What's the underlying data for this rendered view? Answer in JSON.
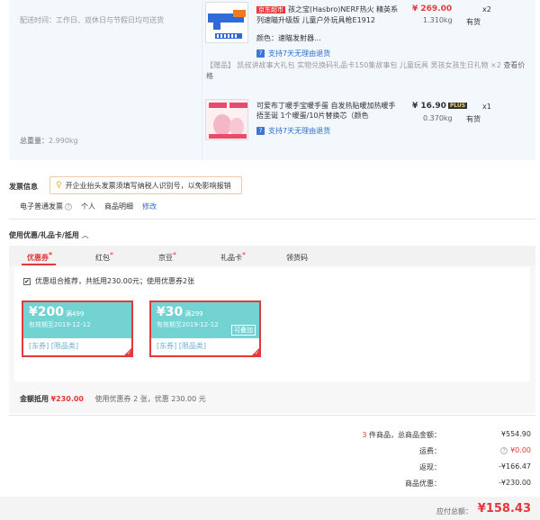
{
  "delivery": {
    "text": "配送时间：工作日、双休日与节假日均可送货"
  },
  "total_weight": {
    "label": "总重量：",
    "value": "2.990kg"
  },
  "products": [
    {
      "tag": "京东超市",
      "title": "孩之宝(Hasbro)NERF热火 精英系列速瞄升级版 儿童户外玩具枪E1912",
      "price": "¥ 269.00",
      "qty": "x2",
      "weight": "1.310kg",
      "stock": "有货",
      "color": "颜色：速瞄发射器...",
      "return": "支持7天无理由退货"
    },
    {
      "title": "可爱布丁暖手宝暖手蛋 自发热贴暖加热暖手捂圣诞 1个暖蛋/10片替换芯（颜色",
      "price": "¥ 16.90",
      "plus": "PLUS",
      "qty": "x1",
      "weight": "0.370kg",
      "stock": "有货",
      "return": "支持7天无理由退货"
    }
  ],
  "gift": {
    "label": "【赠品】",
    "text": "凯叔讲故事大礼包 实物兑换码礼品卡150集故事包 儿童玩具 男孩女孩生日礼物",
    "qty": "×2",
    "link": "查看价格"
  },
  "invoice": {
    "title": "发票信息",
    "tip": "开企业抬头发票须填写纳税人识别号，以免影响报销",
    "type": "电子普通发票",
    "person": "个人",
    "detail": "商品明细",
    "edit": "修改"
  },
  "coupons": {
    "title": "使用优惠/礼品卡/抵用",
    "arrow": "︿",
    "tabs": [
      {
        "label": "优惠券",
        "star": "*"
      },
      {
        "label": "红包",
        "star": "*"
      },
      {
        "label": "京豆",
        "star": "*"
      },
      {
        "label": "礼品卡",
        "star": "*"
      },
      {
        "label": "领货码",
        "star": ""
      }
    ],
    "combo_text": "优惠组合推荐，共抵用230.00元；使用优惠券2张",
    "combo_check": "✔",
    "items": [
      {
        "amount": "¥200",
        "cond": "满499",
        "expire": "有效期至2019-12-12",
        "tags": "[东券]  [限品类]",
        "stack": ""
      },
      {
        "amount": "¥30",
        "cond": "满299",
        "expire": "有效期至2019-12-12",
        "tags": "[东券]  [限品类]",
        "stack": "可叠加"
      }
    ],
    "deduct_label": "金额抵用",
    "deduct_value": "¥230.00",
    "deduct_note": "使用优惠券 2 张，优惠 230.00 元"
  },
  "summary": {
    "count_num": "3",
    "count_text": " 件商品，总商品金额：",
    "goods_total": "¥554.90",
    "shipping_label": "运费：",
    "shipping_value": "¥0.00",
    "rebate_label": "返现：",
    "rebate_value": "-¥166.47",
    "discount_label": "商品优惠：",
    "discount_value": "-¥230.00",
    "pay_label": "应付总额：",
    "pay_value": "¥158.43"
  },
  "colors": {
    "accent": "#e4393c",
    "coupon": "#73d3d3",
    "link": "#2d6ec9"
  }
}
